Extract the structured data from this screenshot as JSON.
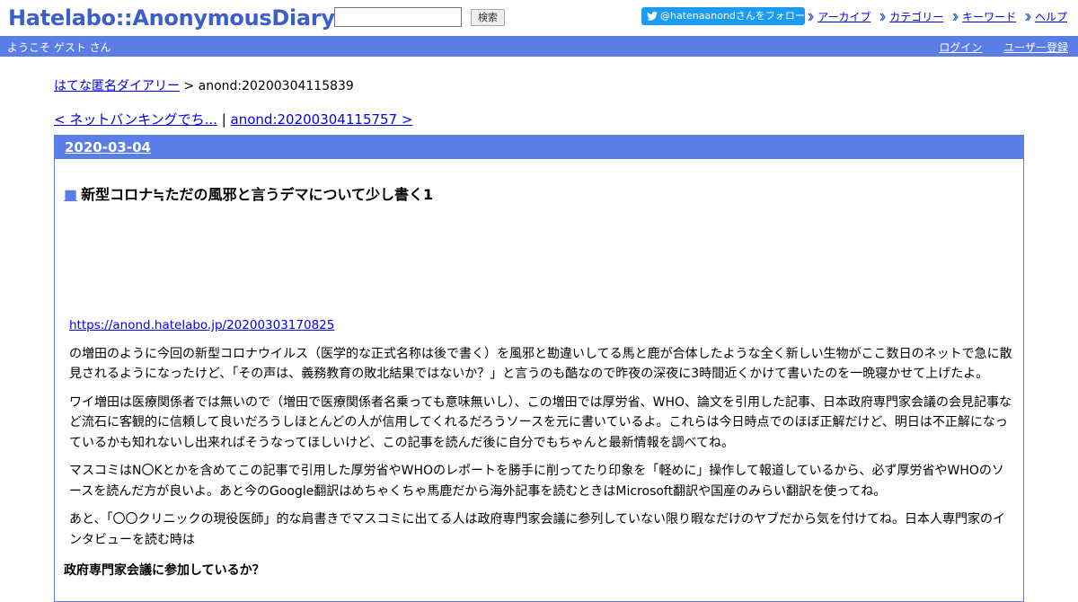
{
  "header": {
    "logo": "Hatelabo::AnonymousDiary",
    "search_button": "検索",
    "search_value": "",
    "follow_label": "@hatenaanondさんをフォロー",
    "nav": [
      "アーカイブ",
      "カテゴリー",
      "キーワード",
      "ヘルプ"
    ]
  },
  "bar": {
    "welcome": "ようこそ ゲスト さん",
    "login": "ログイン",
    "register": "ユーザー登録"
  },
  "breadcrumb": {
    "home": "はてな匿名ダイアリー",
    "separator": " > ",
    "current": "anond:20200304115839"
  },
  "pager": {
    "prev": "< ネットバンキングでち...",
    "separator": " | ",
    "next": "anond:20200304115757 >"
  },
  "section": {
    "date": "2020-03-04",
    "title_marker": "■",
    "title": "新型コロナ≒ただの風邪と言うデマについて少し書く1",
    "source_link": "https://anond.hatelabo.jp/20200303170825",
    "paragraphs": [
      "の増田のように今回の新型コロナウイルス（医学的な正式名称は後で書く）を風邪と勘違いしてる馬と鹿が合体したような全く新しい生物がここ数日のネットで急に散見されるようになったけど、「その声は、義務教育の敗北結果ではないか？」と言うのも酷なので昨夜の深夜に3時間近くかけて書いたのを一晩寝かせて上げたよ。",
      "ワイ増田は医療関係者では無いので（増田で医療関係者名乗っても意味無いし）、この増田では厚労省、WHO、論文を引用した記事、日本政府専門家会議の会見記事など流石に客観的に信頼して良いだろうしほとんどの人が信用してくれるだろうソースを元に書いているよ。これらは今日時点でのほぼ正解だけど、明日は不正解になっているかも知れないし出来ればそうなってほしいけど、この記事を読んだ後に自分でもちゃんと最新情報を調べてね。",
      "マスコミはN〇Kとかを含めてこの記事で引用した厚労省やWHOのレポートを勝手に削ってたり印象を「軽めに」操作して報道しているから、必ず厚労省やWHOのソースを読んだ方が良いよ。あと今のGoogle翻訳はめちゃくちゃ馬鹿だから海外記事を読むときはMicrosoft翻訳や国産のみらい翻訳を使ってね。",
      "あと、「〇〇クリニックの現役医師」的な肩書きでマスコミに出てる人は政府専門家会議に参列していない限り暇なだけのヤブだから気を付けてね。日本人専門家のインタビューを読む時は"
    ],
    "cut_heading": "政府専門家会議に参加しているか？"
  },
  "colors": {
    "brand_blue": "#5a7ee6",
    "logo_blue": "#3d5fcc",
    "twitter_blue": "#1d9bf0"
  }
}
